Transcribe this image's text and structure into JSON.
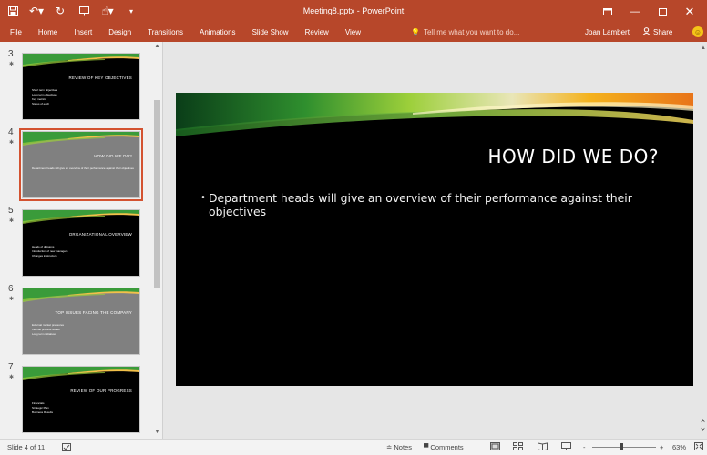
{
  "window": {
    "title": "Meeting8.pptx - PowerPoint",
    "accent_color": "#b7472a",
    "qat_icons": [
      "save-icon",
      "undo-icon",
      "redo-icon",
      "slideshow-start-icon",
      "touch-mode-icon",
      "customize-qat-icon"
    ]
  },
  "ribbon": {
    "tabs": [
      "File",
      "Home",
      "Insert",
      "Design",
      "Transitions",
      "Animations",
      "Slide Show",
      "Review",
      "View"
    ],
    "tell_me": "Tell me what you want to do...",
    "user": "Joan Lambert",
    "share": "Share"
  },
  "thumbnails": [
    {
      "num": "3",
      "title": "REVIEW OF KEY OBJECTIVES",
      "bg": "#000000",
      "bullets": [
        "Short term objectives",
        "Long term objectives",
        "Key metrics",
        "Status of each"
      ]
    },
    {
      "num": "4",
      "title": "HOW DID WE DO?",
      "bg": "#808080",
      "selected": true,
      "bullets": [
        "Department heads will give an overview of their performance against their objectives"
      ]
    },
    {
      "num": "5",
      "title": "ORGANIZATIONAL OVERVIEW",
      "bg": "#000000",
      "bullets": [
        "Heads of divisions",
        "Introduction of new managers",
        "Changes in structure"
      ]
    },
    {
      "num": "6",
      "title": "TOP ISSUES FACING THE COMPANY",
      "bg": "#808080",
      "bullets": [
        "External market pressures",
        "Internal process issues",
        "Long term initiatives"
      ]
    },
    {
      "num": "7",
      "title": "REVIEW OF OUR PROGRESS",
      "bg": "#000000",
      "bullets": [
        "Financials",
        "Strategic Plan",
        "Business Results"
      ]
    }
  ],
  "slide": {
    "title": "HOW DID WE DO?",
    "body": "Department heads will give an overview of their performance against their objectives"
  },
  "status": {
    "slide_indicator": "Slide 4 of 11",
    "notes": "Notes",
    "comments": "Comments",
    "zoom_minus": "-",
    "zoom_plus": "+",
    "zoom": "63%"
  }
}
